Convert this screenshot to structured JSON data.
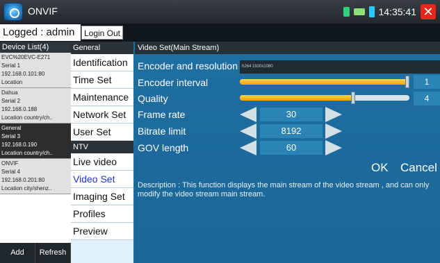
{
  "titlebar": {
    "app_icon": "onvif-logo-icon",
    "title": "ONVIF",
    "clock": "14:35:41",
    "close_glyph": "✕"
  },
  "login": {
    "status": "Logged : admin",
    "login_out_label": "Login Out"
  },
  "devices": {
    "header": "Device List(4)",
    "items": [
      {
        "name": "EVC%20EVC-E271",
        "serial": "Serial 1",
        "ip": "192.168.0.101:80",
        "location": "Location",
        "selected": false
      },
      {
        "name": "Dahua",
        "serial": "Serial 2",
        "ip": "192.168.0.188",
        "location": "Location country/ch..",
        "selected": false
      },
      {
        "name": "General",
        "serial": "Serial 3",
        "ip": "192.168.0.190",
        "location": "Location country/ch..",
        "selected": true
      },
      {
        "name": "ONVIF",
        "serial": "Serial 4",
        "ip": "192.168.0.201:80",
        "location": "Location city/shenz..",
        "selected": false
      }
    ],
    "add_label": "Add",
    "refresh_label": "Refresh"
  },
  "menu": {
    "general_group": "General",
    "general_items": [
      "Identification",
      "Time Set",
      "Maintenance",
      "Network Set",
      "User Set"
    ],
    "ntv_group": "NTV",
    "ntv_items": [
      "Live video",
      "Video Set",
      "Imaging Set",
      "Profiles",
      "Preview"
    ],
    "active": "Video Set"
  },
  "main": {
    "header": "Video Set(Main Stream)",
    "encoder_label": "Encoder and resolution",
    "encoder_value": "h264 1920x1080",
    "interval_label": "Encoder interval",
    "interval_value": "1",
    "interval_fraction": 0.99,
    "quality_label": "Quality",
    "quality_value": "4",
    "quality_fraction": 0.67,
    "frame_rate_label": "Frame rate",
    "frame_rate_value": "30",
    "bitrate_label": "Bitrate limit",
    "bitrate_value": "8192",
    "gov_label": "GOV length",
    "gov_value": "60",
    "ok_label": "OK",
    "cancel_label": "Cancel",
    "description": "Description : This function displays the main stream of the video stream , and can only modify the video stream main stream."
  },
  "colors": {
    "accent_blue": "#1f6fa2",
    "slider_orange": "#f2a300",
    "close_red": "#e8261b"
  }
}
